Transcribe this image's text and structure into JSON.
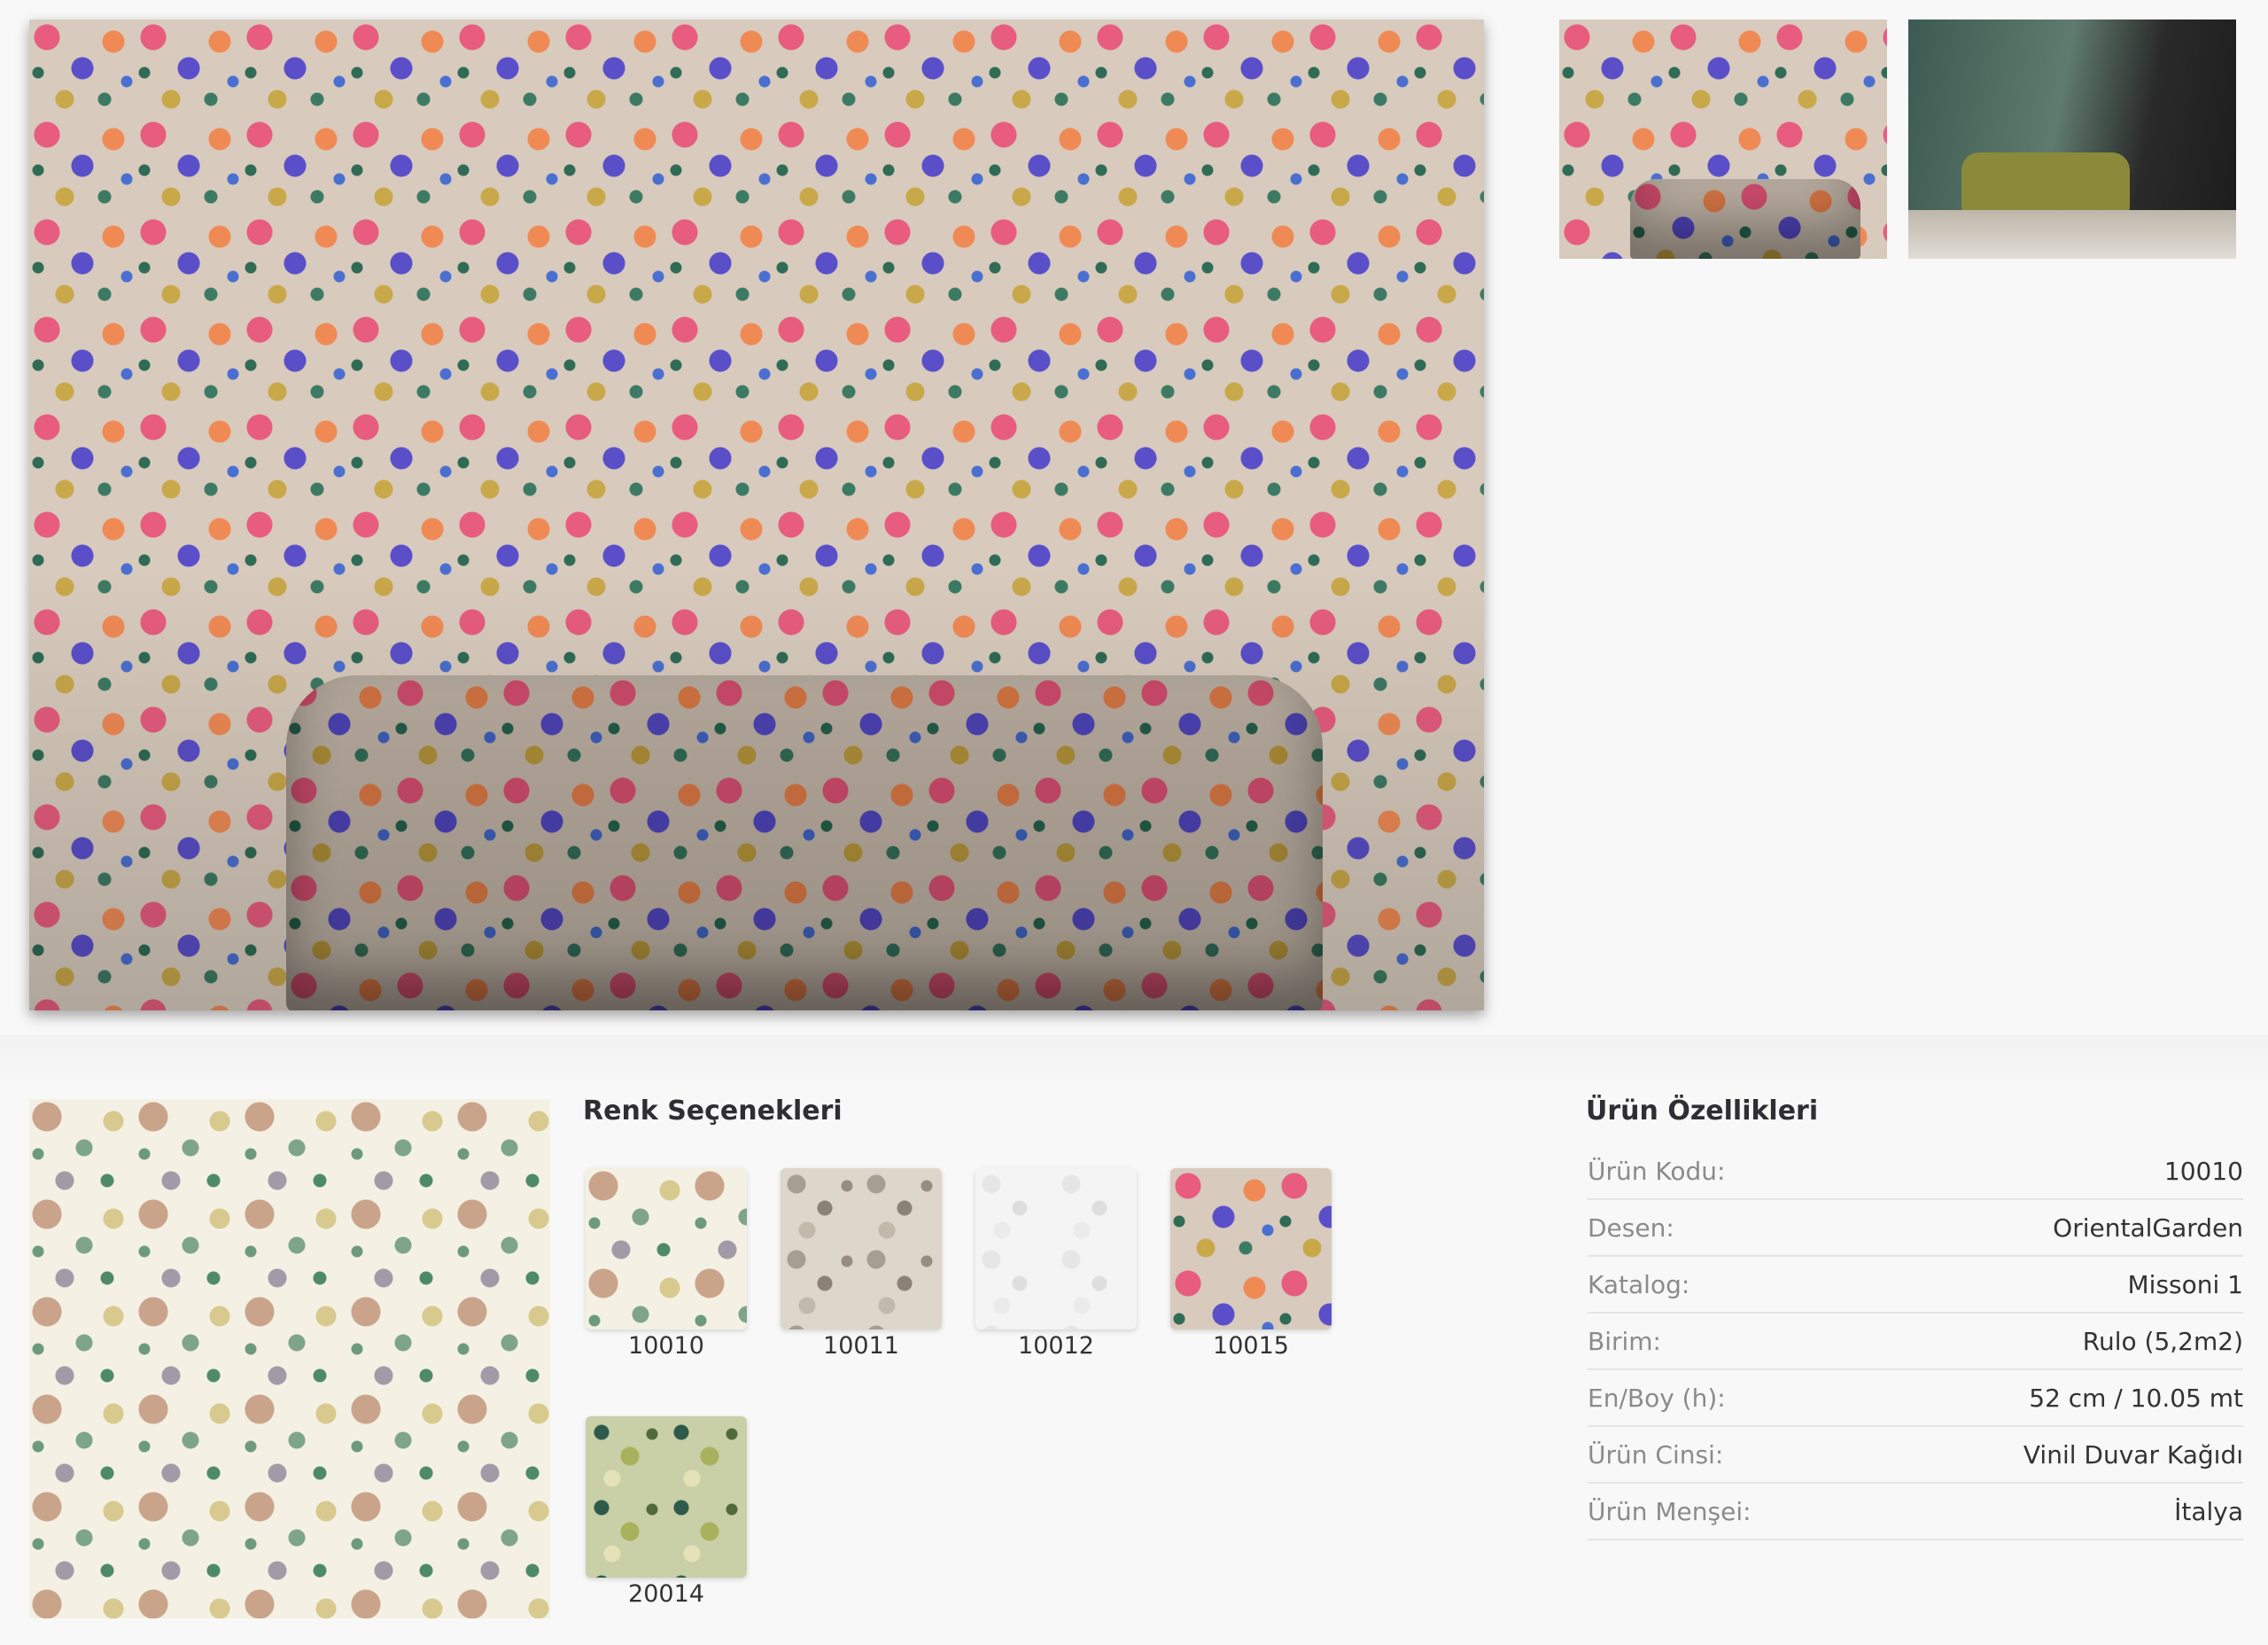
{
  "gallery": {
    "main_image": "wallpaper-room-sofa",
    "thumbnails": [
      "wallpaper-room-sofa-thumb",
      "living-room-green-sofa-thumb"
    ]
  },
  "colors_section": {
    "title": "Renk Seçenekleri",
    "swatches": [
      {
        "code": "10010"
      },
      {
        "code": "10011"
      },
      {
        "code": "10012"
      },
      {
        "code": "10015"
      },
      {
        "code": "20014"
      }
    ]
  },
  "specs": {
    "title": "Ürün Özellikleri",
    "rows": [
      {
        "label": "Ürün Kodu:",
        "value": "10010"
      },
      {
        "label": "Desen:",
        "value": "OrientalGarden"
      },
      {
        "label": "Katalog:",
        "value": "Missoni 1"
      },
      {
        "label": "Birim:",
        "value": "Rulo (5,2m2)"
      },
      {
        "label": "En/Boy (h):",
        "value": "52 cm / 10.05 mt"
      },
      {
        "label": "Ürün Cinsi:",
        "value": "Vinil Duvar Kağıdı"
      },
      {
        "label": "Ürün Menşei:",
        "value": "İtalya"
      }
    ]
  }
}
